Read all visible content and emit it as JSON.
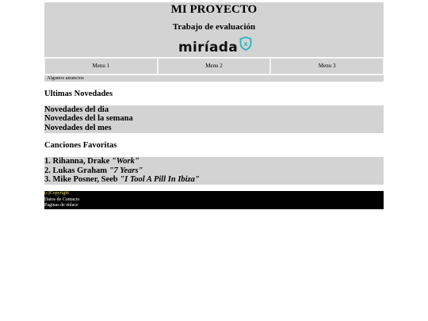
{
  "header": {
    "title": "MI PROYECTO",
    "subtitle": "Trabajo de evaluación",
    "logo_text": "miríada",
    "logo_mark": "x"
  },
  "menu": [
    {
      "label": "Menu 1"
    },
    {
      "label": "Menu 2"
    },
    {
      "label": "Menu 3"
    }
  ],
  "ads": {
    "text": "Algunos anuncios"
  },
  "news": {
    "heading": "Ultimas Novedades",
    "items": [
      "Novedades del dia",
      "Novedades del la semana",
      "Novedades del mes"
    ]
  },
  "songs": {
    "heading": "Canciones Favoritas",
    "items": [
      {
        "prefix": "1. Rihanna, Drake ",
        "title": "\"Work\""
      },
      {
        "prefix": "2. Lukas Graham ",
        "title": "\"7 Years\""
      },
      {
        "prefix": "3. Mike Posner, Seeb ",
        "title": "\"I Tool A Pill In Ibiza\""
      }
    ]
  },
  "footer": {
    "copyright": "(c)Copyright",
    "contact": "Datos de Contacto",
    "links": "Paginas de enlace"
  },
  "colors": {
    "panel": "#d3d3d3",
    "footer_bg": "#000000",
    "copyright_text": "#f0d878",
    "logo_badge": "#2bb3c0"
  }
}
